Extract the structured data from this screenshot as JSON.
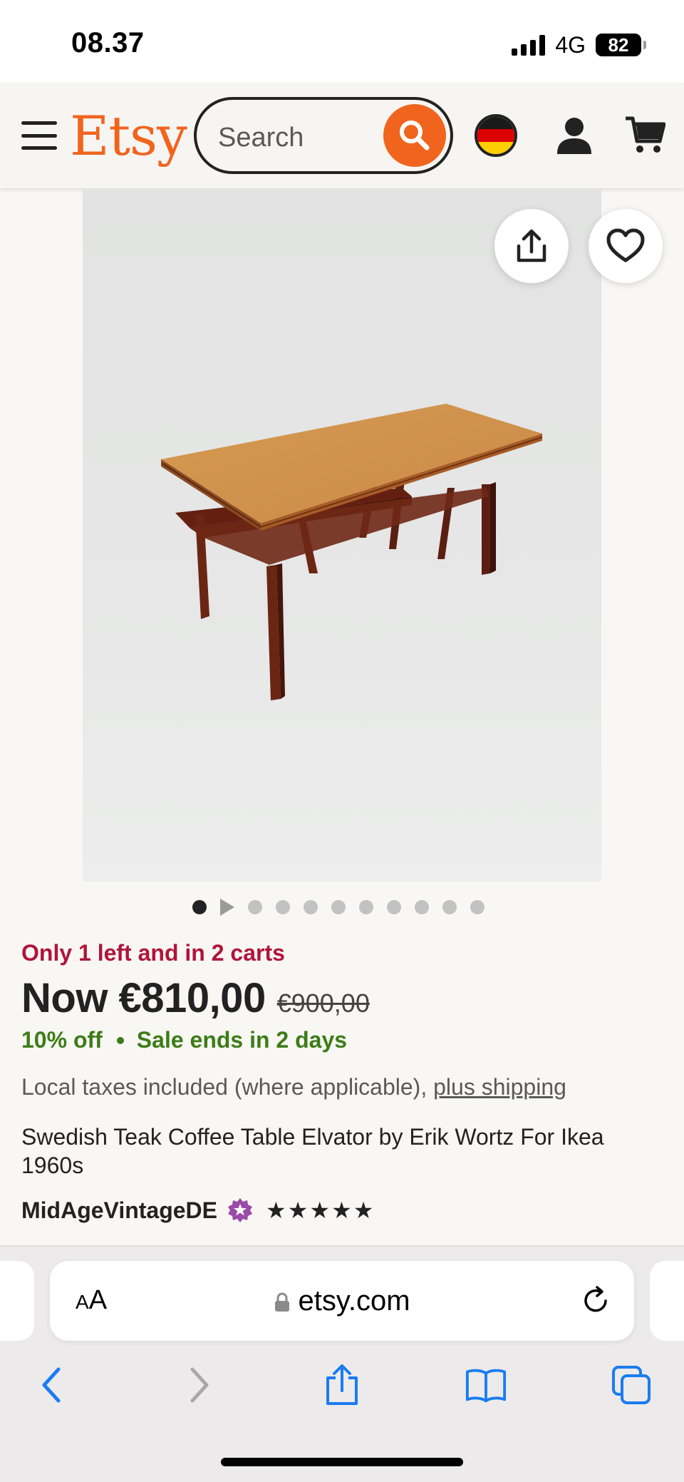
{
  "status_bar": {
    "time": "08.37",
    "network": "4G",
    "battery": "82"
  },
  "header": {
    "logo": "Etsy",
    "search_placeholder": "Search",
    "colors": {
      "brand": "#f1641e"
    }
  },
  "product": {
    "image_alt": "Teak coffee table on grey background",
    "carousel_total_dots": 11,
    "carousel_active_index": 0,
    "stock_notice": "Only 1 left and in 2 carts",
    "price": "Now €810,00",
    "original_price": "€900,00",
    "discount": "10% off",
    "sale_ends": "Sale ends in 2 days",
    "tax_text": "Local taxes included (where applicable), ",
    "shipping_link": "plus shipping",
    "title": "Swedish Teak Coffee Table Elvator by Erik Wortz For Ikea 1960s",
    "shop_name": "MidAgeVintageDE",
    "rating_stars": "★★★★★",
    "rating": 5
  },
  "browser": {
    "text_size_label_small": "A",
    "text_size_label_large": "A",
    "url": "etsy.com"
  }
}
